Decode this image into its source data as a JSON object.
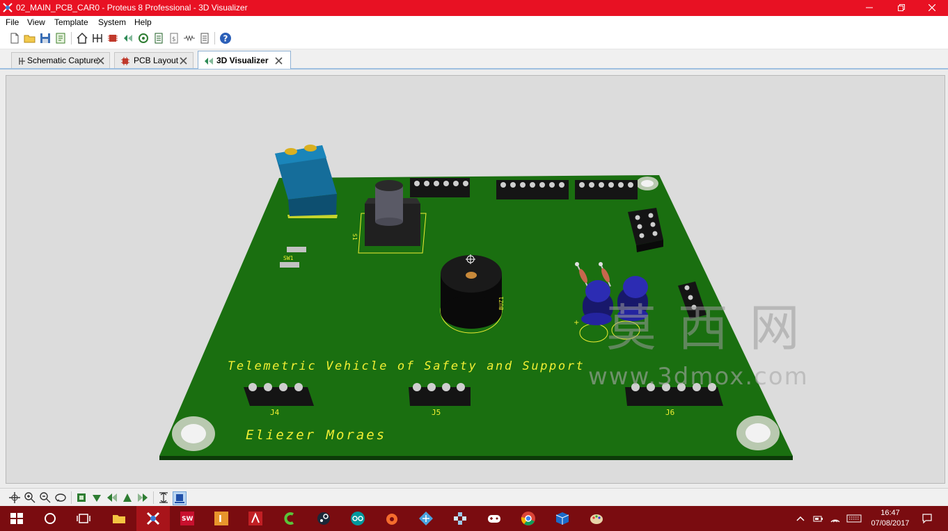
{
  "window": {
    "title": "02_MAIN_PCB_CAR0 - Proteus 8 Professional - 3D Visualizer",
    "accent_color": "#e81123"
  },
  "menu": {
    "items": [
      "File",
      "View",
      "Template",
      "System",
      "Help"
    ]
  },
  "toolbar": {
    "icons": [
      "new-file-icon",
      "open-folder-icon",
      "save-icon",
      "import-icon",
      "home-icon",
      "schematic-icon",
      "pcb-icon",
      "3d-icon",
      "gerber-icon",
      "bom-icon",
      "design-notes-icon",
      "resistor-icon",
      "document-icon",
      "help-icon"
    ]
  },
  "tabs": [
    {
      "label": "Schematic Capture",
      "icon": "schematic-icon",
      "active": false
    },
    {
      "label": "PCB Layout",
      "icon": "pcb-chip-icon",
      "active": false
    },
    {
      "label": "3D Visualizer",
      "icon": "3d-visualizer-icon",
      "active": true
    }
  ],
  "board": {
    "title_text": "Telemetric Vehicle of Safety and Support",
    "author_text": "Eliezer Moraes",
    "board_color": "#1a6f10",
    "silkscreen_color": "#f1ef33",
    "labels": {
      "j4": "J4",
      "j5": "J5",
      "j6": "J6",
      "sw1": "SW1",
      "s1": "S1",
      "buz1": "BUZ1",
      "led_plus": "+",
      "led_minus": "-"
    }
  },
  "watermark": {
    "cjk": "莫 西 网",
    "url": "www.3dmox.com"
  },
  "view_controls": {
    "icons": [
      "pan-icon",
      "zoom-in-icon",
      "zoom-out-icon",
      "orbit-icon",
      "view-front-icon",
      "view-top-icon",
      "view-left-icon",
      "view-back-icon",
      "view-right-icon",
      "height-icon",
      "toggle-components-icon"
    ]
  },
  "taskbar": {
    "apps": [
      "file-explorer-icon",
      "proteus-icon",
      "solidworks-icon",
      "inventor-icon",
      "autocad-icon",
      "camtasia-icon",
      "steam-icon",
      "arduino-icon",
      "origin-icon",
      "network-icon",
      "bluetooth-icon",
      "gamepad-icon",
      "chrome-icon",
      "virtualbox-icon",
      "paint-icon"
    ],
    "time": "16:47",
    "date": "07/08/2017"
  }
}
